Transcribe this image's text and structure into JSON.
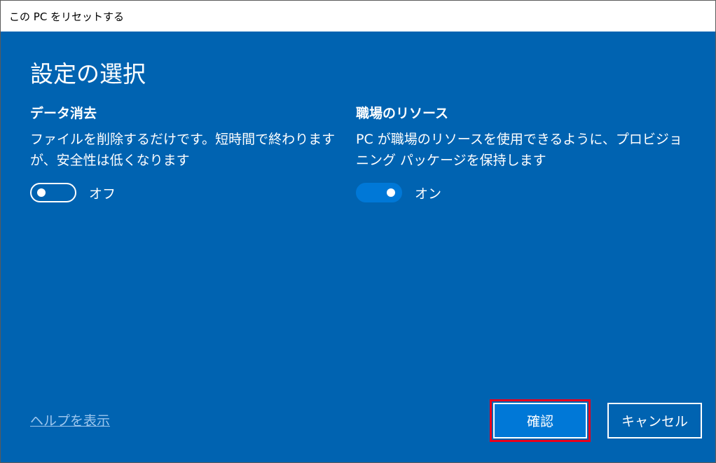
{
  "window": {
    "title": "この PC をリセットする"
  },
  "page": {
    "title": "設定の選択"
  },
  "data_erase": {
    "heading": "データ消去",
    "description": "ファイルを削除するだけです。短時間で終わりますが、安全性は低くなります",
    "toggle_state": "off",
    "toggle_label": "オフ"
  },
  "workplace_resources": {
    "heading": "職場のリソース",
    "description": "PC が職場のリソースを使用できるように、プロビジョニング パッケージを保持します",
    "toggle_state": "on",
    "toggle_label": "オン"
  },
  "footer": {
    "help_link": "ヘルプを表示",
    "confirm_label": "確認",
    "cancel_label": "キャンセル"
  },
  "colors": {
    "background": "#0063b1",
    "toggle_on": "#0078d7",
    "highlight": "#e8001c"
  }
}
